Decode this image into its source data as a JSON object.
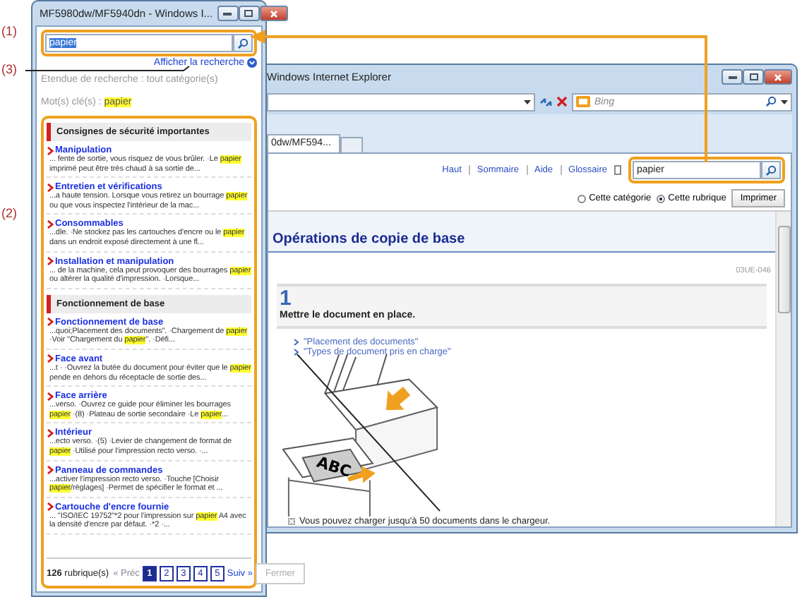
{
  "callouts": [
    {
      "label": "(1)"
    },
    {
      "label": "(3)"
    },
    {
      "label": "(2)"
    }
  ],
  "help_window": {
    "title": "MF5980dw/MF5940dn - Windows I...",
    "search": {
      "value": "papier"
    },
    "show_search_link": "Afficher la recherche",
    "scope": "Etendue de recherche : tout catégorie(s)",
    "keywords_label": "Mot(s) clé(s) :",
    "keyword": "papier",
    "sections": [
      {
        "title": "Consignes de sécurité importantes",
        "items": [
          {
            "title": "Manipulation",
            "snippet": "... fente de sortie, vous risquez de vous brûler. ·Le **papier** imprimé peut être très chaud à sa sortie de..."
          },
          {
            "title": "Entretien et vérifications",
            "snippet": "...a haute tension. Lorsque vous retirez un bourrage **papier** ou que vous inspectez l'intérieur de la mac..."
          },
          {
            "title": "Consommables",
            "snippet": "...dle. ·Ne stockez pas les cartouches d'encre ou le **papier** dans un endroit exposé directement à une fl..."
          },
          {
            "title": "Installation et manipulation",
            "snippet": "... de la machine, cela peut provoquer des bourrages **papier** ou altérer la qualité d'impression. ·Lorsque..."
          }
        ]
      },
      {
        "title": "Fonctionnement de base",
        "items": [
          {
            "title": "Fonctionnement de base",
            "snippet": "...quoi;Placement des documents\". ·Chargement de **papier** ·Voir \"Chargement du **papier**\". ·Défi..."
          },
          {
            "title": "Face avant",
            "snippet": "...t · ·Ouvrez la butée du document pour éviter que le **papier** pende en dehors du réceptacle de sortie des..."
          },
          {
            "title": "Face arrière",
            "snippet": "...verso. ·Ouvrez ce guide pour éliminer les bourrages **papier** ·(8) ·Plateau de sortie secondaire ·Le **papier**..."
          },
          {
            "title": "Intérieur",
            "snippet": "...ecto verso. ·(5) ·Levier de changement de format de **papier** ·Utilisé pour l'impression recto verso. ·..."
          },
          {
            "title": "Panneau de commandes",
            "snippet": "...activer l'impression recto verso. ·Touche [Choisir **papier**/réglages] ·Permet de spécifier le format et ..."
          },
          {
            "title": "Cartouche d'encre fournie",
            "snippet": "... \"ISO/IEC 19752\"*2 pour l'impression sur **papier** A4 avec la densité d'encre par défaut. ·*2 ·..."
          }
        ]
      }
    ],
    "footer": {
      "count": "**126** rubrique(s)",
      "prev": "« Préc",
      "pages": [
        {
          "label": "1",
          "selected": true
        },
        {
          "label": "2",
          "selected": false
        },
        {
          "label": "3",
          "selected": false
        },
        {
          "label": "4",
          "selected": false
        },
        {
          "label": "5",
          "selected": false
        }
      ],
      "next": "Suiv »",
      "close": "Fermer"
    }
  },
  "browser": {
    "title": "Windows Internet Explorer",
    "search_engine": "Bing",
    "tab": "0dw/MF594...",
    "nav_links": [
      "Haut",
      "Sommaire",
      "Aide",
      "Glossaire"
    ],
    "search": {
      "value": "papier"
    },
    "scope_options": [
      {
        "label": "Cette catégorie",
        "selected": false
      },
      {
        "label": "Cette rubrique",
        "selected": true
      }
    ],
    "print_button": "Imprimer",
    "page": {
      "heading": "Opérations de copie de base",
      "doc_code": "03UE-046",
      "step_number": "1",
      "step_text": "Mettre le document en place.",
      "links": [
        "\"Placement des documents\"",
        "\"Types de document pris en charge\""
      ],
      "illustration_label": "ABC",
      "note": "Vous pouvez charger jusqu'à 50 documents dans le chargeur."
    }
  }
}
